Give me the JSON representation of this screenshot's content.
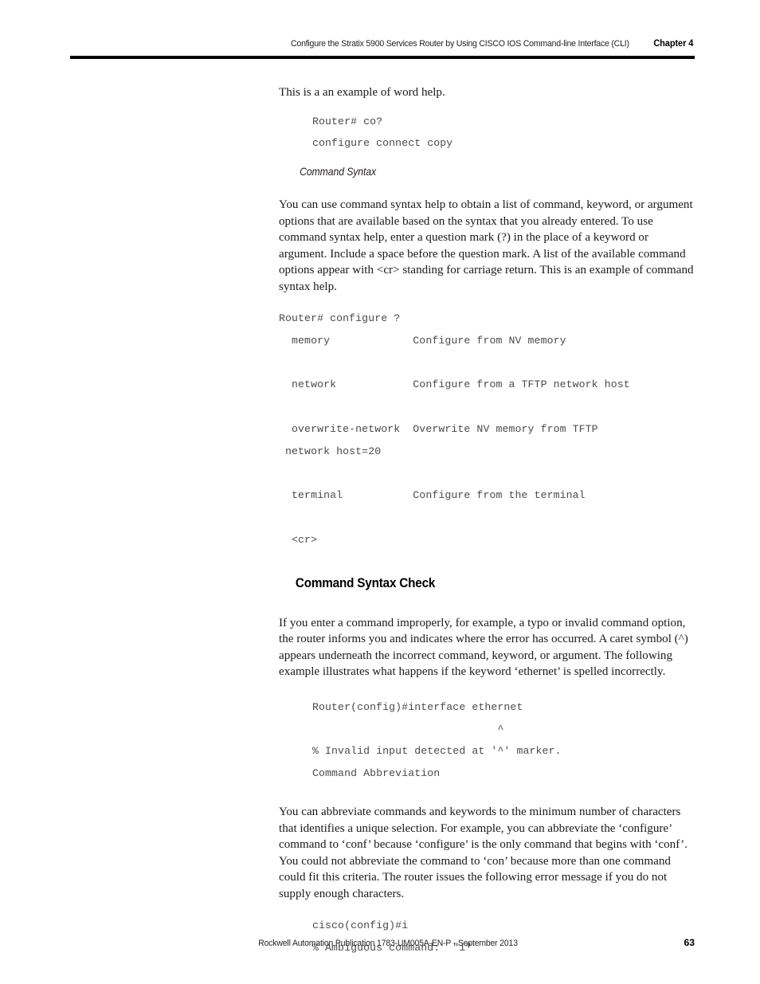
{
  "header": {
    "title": "Configure the Stratix 5900 Services Router by Using CISCO IOS Command-line Interface (CLI)",
    "chapter": "Chapter 4"
  },
  "content": {
    "intro_paragraph": "This is a an example of word help.",
    "word_help_example": "Router# co?",
    "word_help_output": "configure connect copy",
    "command_syntax_heading": "Command Syntax",
    "command_syntax_paragraph": "You can use command syntax help to obtain a list of command, keyword, or argument options that are available based on the syntax that you already entered. To use command syntax help, enter a question mark (?) in the place of a keyword or argument. Include a space before the question mark. A list of the available command options appear with <cr> standing for carriage return. This is an example of command syntax help.",
    "syntax_example_prompt": "Router# configure ?",
    "syntax_example_options": "  memory             Configure from NV memory\n\n  network            Configure from a TFTP network host\n\n  overwrite-network  Overwrite NV memory from TFTP\n network host=20\n\n  terminal           Configure from the terminal\n\n  <cr>",
    "syntax_check_heading": "Command Syntax Check",
    "syntax_check_paragraph": "If you enter a command improperly, for example, a typo or invalid command option, the router informs you and indicates where the error has occurred. A caret symbol (^) appears underneath the incorrect command, keyword, or argument. The following example illustrates what happens if the keyword ‘ethernet’ is spelled incorrectly.",
    "error_example_command": "Router(config)#interface ethernet",
    "error_example_caret": "                             ^",
    "error_example_message": "% Invalid input detected at '^' marker.",
    "error_example_followup": "Command Abbreviation",
    "abbreviation_paragraph": "You can abbreviate commands and keywords to the minimum number of characters that identifies a unique selection. For example, you can abbreviate the ‘configure’ command to ‘conf’ because ‘configure’ is the only command that begins with ‘conf’. You could not abbreviate the command to ‘con’ because more than one command could fit this criteria. The router issues the following error message if you do not supply enough characters.",
    "ambiguous_example_command": "cisco(config)#i",
    "ambiguous_example_message": "% Ambiguous command:  \"i\""
  },
  "footer": {
    "publication": "Rockwell Automation Publication 1783-UM005A-EN-P - September 2013",
    "page_number": "63"
  }
}
